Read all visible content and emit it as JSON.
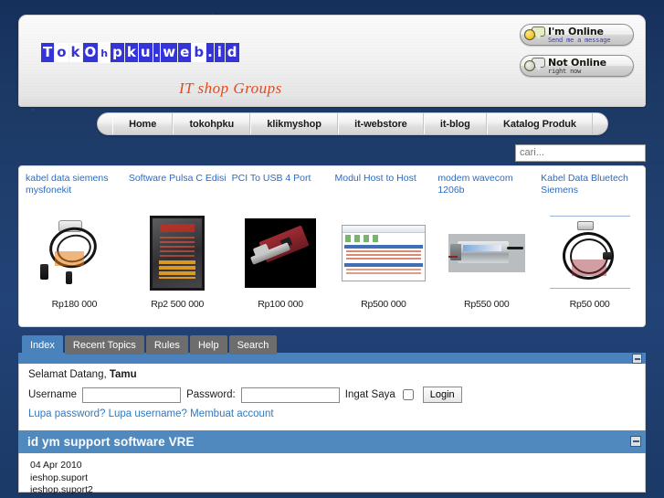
{
  "site": {
    "logo_text": "Tokohpku.web.id",
    "logo_letters": [
      {
        "ch": "T",
        "style": "fill"
      },
      {
        "ch": "o",
        "style": "plain"
      },
      {
        "ch": "k",
        "style": "plain"
      },
      {
        "ch": "O",
        "style": "fill"
      },
      {
        "ch": "h",
        "style": "plain small"
      },
      {
        "ch": "p",
        "style": "fill"
      },
      {
        "ch": "k",
        "style": "fill"
      },
      {
        "ch": "u",
        "style": "fill"
      },
      {
        "ch": ".",
        "style": "fill dot"
      },
      {
        "ch": "w",
        "style": "fill"
      },
      {
        "ch": "e",
        "style": "fill"
      },
      {
        "ch": "b",
        "style": "plain"
      },
      {
        "ch": ".",
        "style": "fill dot"
      },
      {
        "ch": "i",
        "style": "fill"
      },
      {
        "ch": "d",
        "style": "fill"
      }
    ],
    "tagline": "IT shop Groups"
  },
  "status": {
    "online": {
      "line1": "I'm Online",
      "line2": "Send me a message",
      "icon": "smiley-chat-icon"
    },
    "offline": {
      "line1": "Not Online",
      "line2": "right now",
      "icon": "smiley-chat-offline-icon"
    }
  },
  "nav": {
    "items": [
      {
        "label": "Home"
      },
      {
        "label": "tokohpku"
      },
      {
        "label": "klikmyshop"
      },
      {
        "label": "it-webstore"
      },
      {
        "label": "it-blog"
      },
      {
        "label": "Katalog Produk"
      }
    ]
  },
  "search": {
    "placeholder": "cari...",
    "value": ""
  },
  "products": [
    {
      "title": "kabel data siemens mysfonekit",
      "price": "Rp180 000",
      "art": "usb-cable-icon"
    },
    {
      "title": "Software Pulsa C Edisi",
      "price": "Rp2 500 000",
      "art": "dvd-case-icon"
    },
    {
      "title": "PCI To USB 4 Port",
      "price": "Rp100 000",
      "art": "pci-card-icon"
    },
    {
      "title": "Modul Host to Host",
      "price": "Rp500 000",
      "art": "software-window-icon"
    },
    {
      "title": "modem wavecom 1206b",
      "price": "Rp550 000",
      "art": "modem-icon"
    },
    {
      "title": "Kabel Data Bluetech Siemens",
      "price": "Rp50 000",
      "art": "bluetooth-cable-icon"
    }
  ],
  "forum": {
    "tabs": [
      {
        "label": "Index",
        "active": true
      },
      {
        "label": "Recent Topics",
        "active": false
      },
      {
        "label": "Rules",
        "active": false
      },
      {
        "label": "Help",
        "active": false
      },
      {
        "label": "Search",
        "active": false
      }
    ],
    "welcome_prefix": "Selamat Datang, ",
    "welcome_user": "Tamu",
    "username_label": "Username",
    "username_value": "",
    "password_label": "Password:",
    "password_value": "",
    "remember_label": "Ingat Saya",
    "remember_checked": false,
    "login_button": "Login",
    "links": [
      {
        "label": "Lupa password?"
      },
      {
        "label": "Lupa username?"
      },
      {
        "label": "Membuat account"
      }
    ]
  },
  "module": {
    "title": "id ym support software VRE",
    "lines": [
      "04 Apr 2010",
      "ieshop.suport",
      "ieshop.suport2"
    ]
  },
  "colors": {
    "page_background": "#1d3a66",
    "accent_blue": "#4a82bd",
    "module_blue": "#5089be",
    "link_blue": "#3279bd",
    "product_link_blue": "#2d6bbf",
    "tagline_red": "#e8481a",
    "logo_blue": "#3434d8",
    "tab_inactive": "#6d6d6d"
  }
}
